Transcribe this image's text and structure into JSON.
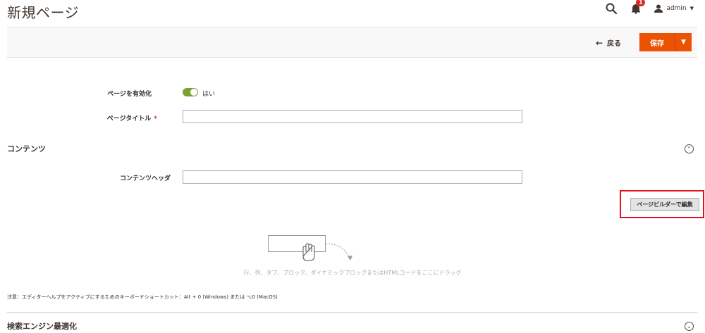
{
  "page": {
    "title": "新規ページ"
  },
  "header": {
    "notification_count": "1",
    "user": "admin"
  },
  "actions": {
    "back_label": "戻る",
    "save_label": "保存"
  },
  "form": {
    "enable_label": "ページを有効化",
    "enable_value": "はい",
    "title_label": "ページタイトル",
    "title_value": ""
  },
  "content_section": {
    "title": "コンテンツ",
    "heading_label": "コンテンツヘッダ",
    "heading_value": "",
    "pagebuilder_button": "ページビルダーで編集",
    "drop_hint": "行、列、タブ、ブロック、ダイナミックブロックまたはHTMLコードをここにドラッグ",
    "shortcut_note": "注意：エディターヘルプをアクティブにするためのキーボードショートカット：Alt + 0 (Windows) または ⌥0 (MacOS)"
  },
  "seo_section": {
    "title": "検索エンジン最適化"
  },
  "icons": [
    "search-icon",
    "bell-icon",
    "user-icon",
    "caret-down-icon",
    "arrow-left-icon",
    "collapse-icon",
    "expand-icon",
    "hand-icon"
  ]
}
